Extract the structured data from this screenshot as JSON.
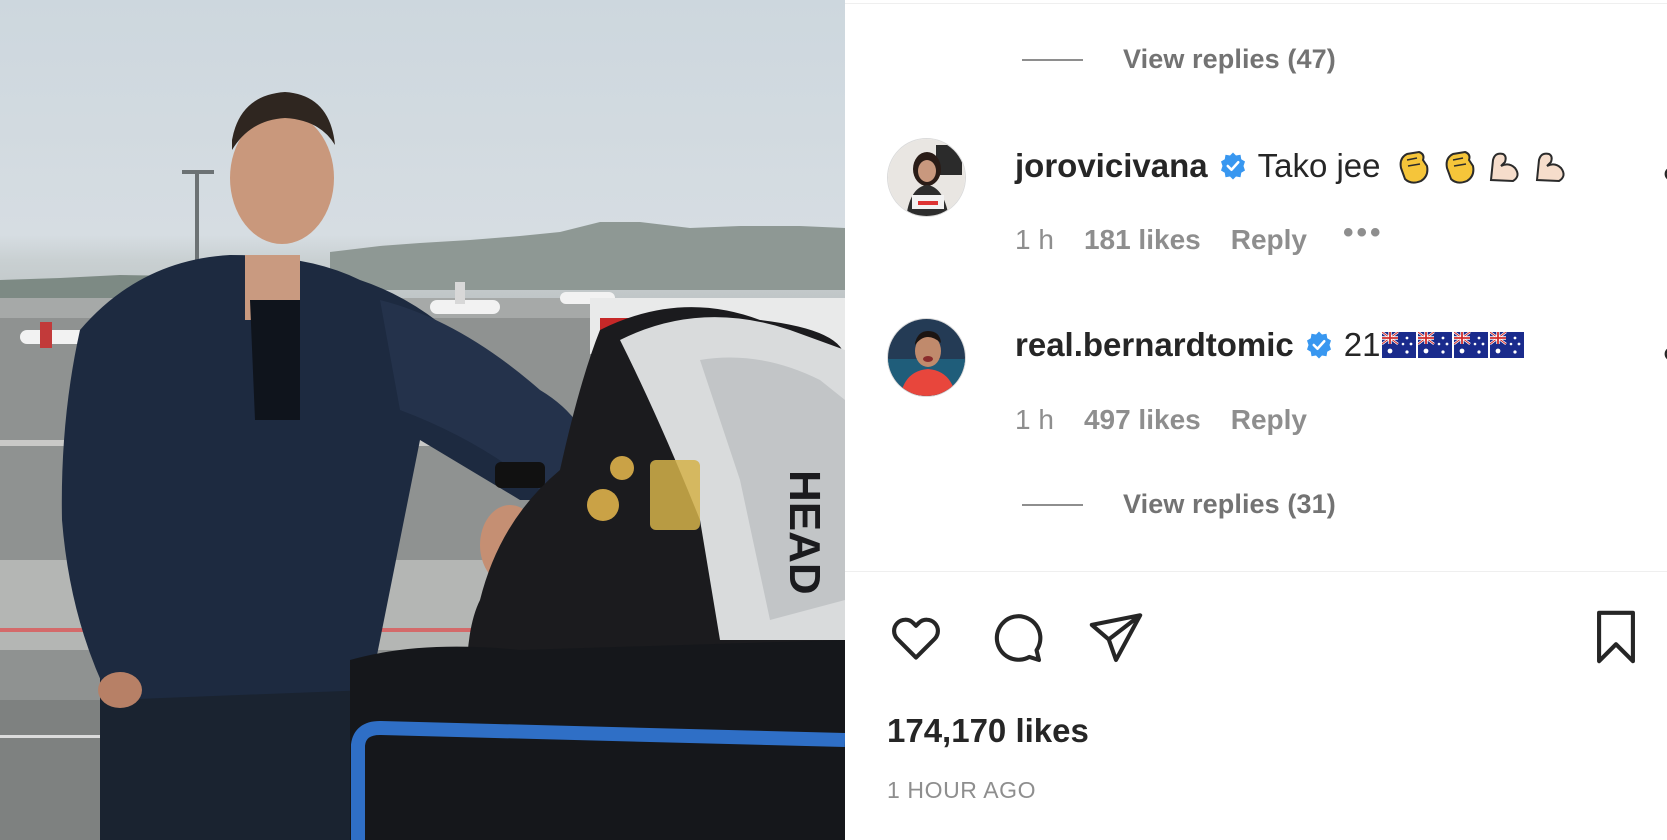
{
  "post": {
    "photo_alt": "",
    "bag_brand": "HEAD",
    "liked_count": "174,170 likes",
    "posted_ago": "1 HOUR AGO"
  },
  "thread": {
    "view_replies_top": "View replies (47)",
    "view_replies_bottom": "View replies (31)"
  },
  "comments": [
    {
      "username": "jorovicivana",
      "verified": true,
      "text": "Tako jee",
      "emoji": [
        "clapping-hands",
        "clapping-hands",
        "flexed-biceps",
        "flexed-biceps"
      ],
      "time": "1 h",
      "likes": "181 likes",
      "reply": "Reply",
      "more": "•••"
    },
    {
      "username": "real.bernardtomic",
      "verified": true,
      "text": "21",
      "emoji": [
        "flag-australia",
        "flag-australia",
        "flag-australia",
        "flag-australia"
      ],
      "time": "1 h",
      "likes": "497 likes",
      "reply": "Reply"
    }
  ],
  "actions": {
    "like": "heart-outline-icon",
    "comment": "speech-bubble-icon",
    "share": "paper-plane-icon",
    "save": "bookmark-icon"
  },
  "colors": {
    "verified": "#3897f0",
    "muted_text": "#8e8e8e",
    "primary_text": "#262626"
  }
}
